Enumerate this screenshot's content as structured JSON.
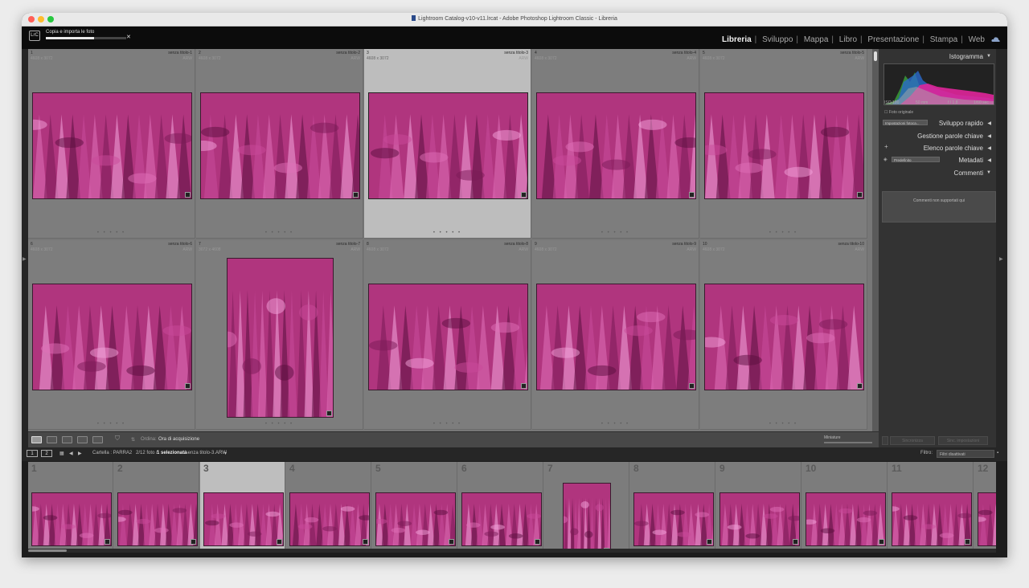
{
  "window": {
    "title": "Lightroom Catalog-v10-v11.lrcat - Adobe Photoshop Lightroom Classic - Libreria"
  },
  "logo": "LrC",
  "import": {
    "label": "Copia e importa le foto",
    "progress": 0.6
  },
  "modules": [
    "Libreria",
    "Sviluppo",
    "Mappa",
    "Libro",
    "Presentazione",
    "Stampa",
    "Web"
  ],
  "active_module": "Libreria",
  "colors": {
    "accent_magenta": "#b0357e",
    "panel_bg": "#333333",
    "grid_bg": "#7d7d7d",
    "selected_cell": "#bdbdbd"
  },
  "grid": {
    "cells": [
      {
        "index": "1",
        "dims": "4608 x 3072",
        "name": "senza titolo-1",
        "ext": "ARW"
      },
      {
        "index": "2",
        "dims": "4608 x 3072",
        "name": "senza titolo-2",
        "ext": "ARW"
      },
      {
        "index": "3",
        "dims": "4608 x 3072",
        "name": "senza titolo-3",
        "ext": "ARW"
      },
      {
        "index": "4",
        "dims": "4608 x 3072",
        "name": "senza titolo-4",
        "ext": "ARW"
      },
      {
        "index": "5",
        "dims": "4608 x 3072",
        "name": "senza titolo-5",
        "ext": "ARW"
      },
      {
        "index": "6",
        "dims": "4608 x 3072",
        "name": "senza titolo-6",
        "ext": "ARW"
      },
      {
        "index": "7",
        "dims": "3072 x 4608",
        "name": "senza titolo-7",
        "ext": "ARW"
      },
      {
        "index": "8",
        "dims": "4608 x 3072",
        "name": "senza titolo-8",
        "ext": "ARW"
      },
      {
        "index": "9",
        "dims": "4608 x 3072",
        "name": "senza titolo-9",
        "ext": "ARW"
      },
      {
        "index": "10",
        "dims": "4608 x 3072",
        "name": "senza titolo-10",
        "ext": "ARW"
      }
    ],
    "dots": "• • • • •"
  },
  "toolbar": {
    "sort_label": "Ordina:",
    "sort_value": "Ora di acquisizione",
    "size_label": "Miniature"
  },
  "right_panel": {
    "histogram": {
      "title": "Istogramma",
      "iso": "ISO 100",
      "focal": "50 mm",
      "aperture": "f / 1,8",
      "shutter": "1/60 sec",
      "original": "Foto originale"
    },
    "quick_develop": {
      "title": "Sviluppo rapido",
      "preset": "Impostazioni fotoca..."
    },
    "keywording": {
      "title": "Gestione parole chiave"
    },
    "keyword_list": {
      "title": "Elenco parole chiave",
      "plus": "+"
    },
    "metadata": {
      "title": "Metadati",
      "preset": "Predefinito"
    },
    "comments": {
      "title": "Commenti",
      "text": "Commenti non supportati qui"
    },
    "sync_meta": "Sincronizza",
    "sync_settings": "Sinc. impostazioni"
  },
  "filmstrip_bar": {
    "path": "Cartella : PARRA2",
    "count": "2/12 foto /",
    "selected": "1 selezionata",
    "file": "/senza titolo-3.ARW",
    "filter_label": "Filtro:",
    "filter_value": "Filtri disattivati",
    "screen1": "1",
    "screen2": "2"
  },
  "filmstrip": {
    "numbers": [
      "1",
      "2",
      "3",
      "4",
      "5",
      "6",
      "7",
      "8",
      "9",
      "10",
      "11",
      "12"
    ]
  }
}
